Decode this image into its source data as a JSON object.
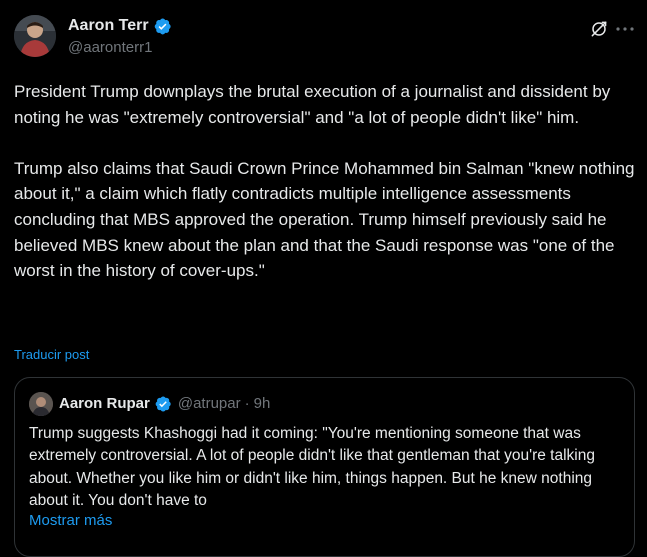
{
  "author": {
    "name": "Aaron Terr",
    "handle": "@aaronterr1"
  },
  "tweet": {
    "text": "President Trump downplays the brutal execution of a journalist and dissident by noting he was \"extremely controversial\" and \"a lot of people didn't like\" him.\n\nTrump also claims that Saudi Crown Prince Mohammed bin Salman \"knew nothing about it,\" a claim which flatly contradicts multiple intelligence assessments concluding that MBS approved the operation. Trump himself previously said he believed MBS knew about the plan and that the Saudi response was \"one of the worst in the history of cover-ups.\"",
    "translate_label": "Traducir post"
  },
  "quote": {
    "name": "Aaron Rupar",
    "handle": "@atrupar",
    "separator": "·",
    "time": "9h",
    "text": "Trump suggests Khashoggi had it coming: \"You're mentioning someone that was extremely controversial. A lot of people didn't like that gentleman that you're talking about. Whether you like him or didn't like him, things happen. But he knew nothing about it. You don't have to",
    "show_more_label": "Mostrar más"
  },
  "icons": {
    "verified": "verified-badge-icon",
    "grok": "grok-icon",
    "more": "more-options-icon"
  },
  "colors": {
    "background": "#000000",
    "text": "#e7e9ea",
    "secondary_text": "#71767b",
    "accent": "#1d9bf0",
    "border": "#2f3336"
  }
}
